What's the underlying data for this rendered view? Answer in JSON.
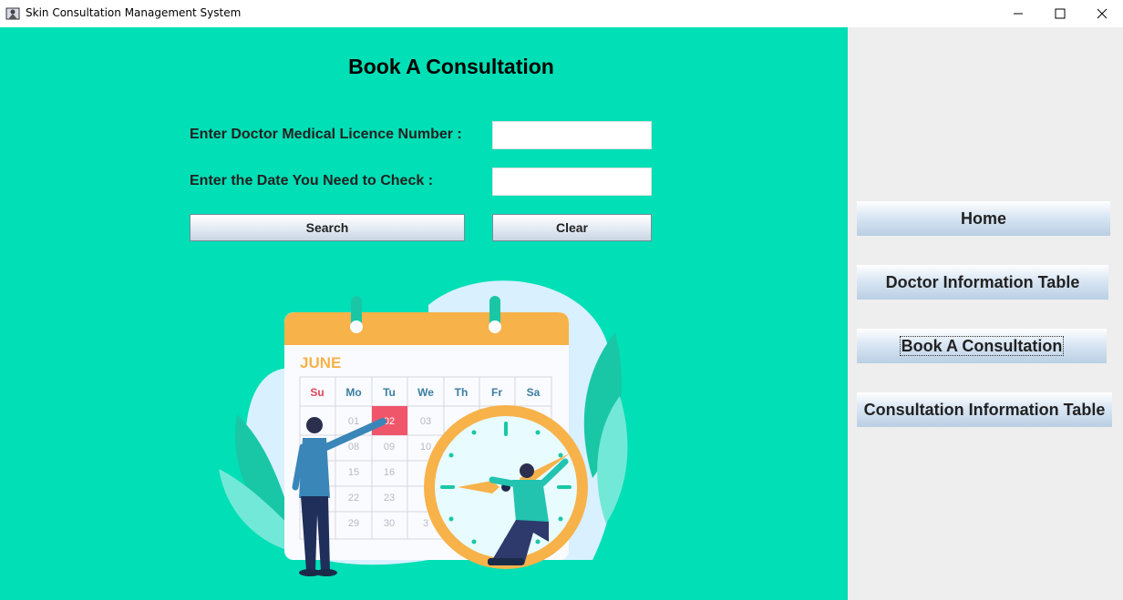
{
  "window": {
    "title": "Skin Consultation Management System",
    "controls": [
      "minimize-icon",
      "maximize-icon",
      "close-icon"
    ]
  },
  "main": {
    "title": "Book A Consultation",
    "licence_label": "Enter Doctor Medical Licence Number :",
    "licence_value": "",
    "date_label": "Enter the Date You Need to Check :",
    "date_value": "",
    "search_label": "Search",
    "clear_label": "Clear",
    "calendar": {
      "month": "JUNE",
      "days": [
        "Su",
        "Mo",
        "Tu",
        "We",
        "Th",
        "Fr",
        "Sa"
      ],
      "dates": [
        "01",
        "02",
        "03",
        "08",
        "09",
        "10",
        "15",
        "16",
        "22",
        "23",
        "29",
        "30",
        "3"
      ],
      "highlight": "02"
    },
    "colors": {
      "background": "#00dfb5",
      "accent": "#f7b24a",
      "highlight": "#f0566a"
    }
  },
  "sidebar": {
    "items": [
      {
        "label": "Home"
      },
      {
        "label": "Doctor Information Table"
      },
      {
        "label": "Book A Consultation"
      },
      {
        "label": "Consultation Information Table"
      }
    ]
  }
}
